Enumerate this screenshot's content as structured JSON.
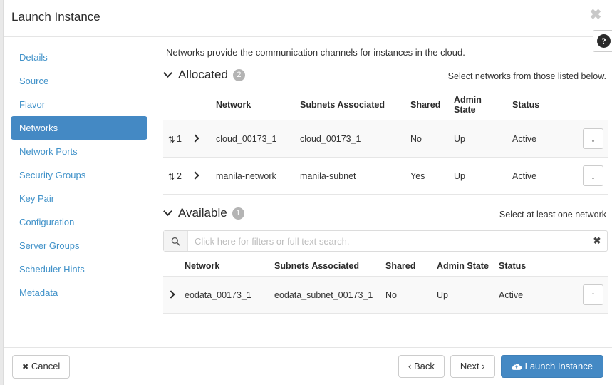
{
  "window": {
    "title": "Launch Instance",
    "close_label": "✖",
    "help_label": "?"
  },
  "sidebar": {
    "items": [
      {
        "label": "Details",
        "active": false
      },
      {
        "label": "Source",
        "active": false
      },
      {
        "label": "Flavor",
        "active": false
      },
      {
        "label": "Networks",
        "active": true
      },
      {
        "label": "Network Ports",
        "active": false
      },
      {
        "label": "Security Groups",
        "active": false
      },
      {
        "label": "Key Pair",
        "active": false
      },
      {
        "label": "Configuration",
        "active": false
      },
      {
        "label": "Server Groups",
        "active": false
      },
      {
        "label": "Scheduler Hints",
        "active": false
      },
      {
        "label": "Metadata",
        "active": false
      }
    ]
  },
  "main": {
    "intro": "Networks provide the communication channels for instances in the cloud.",
    "allocated": {
      "title": "Allocated",
      "count": "2",
      "hint": "Select networks from those listed below.",
      "columns": [
        "",
        "",
        "Network",
        "Subnets Associated",
        "Shared",
        "Admin State",
        "Status",
        ""
      ],
      "rows": [
        {
          "handle": "⇅",
          "index": "1",
          "network": "cloud_00173_1",
          "subnets": "cloud_00173_1",
          "shared": "No",
          "admin_state": "Up",
          "status": "Active",
          "action_icon": "↓",
          "action_name": "deallocate-network-button"
        },
        {
          "handle": "⇅",
          "index": "2",
          "network": "manila-network",
          "subnets": "manila-subnet",
          "shared": "Yes",
          "admin_state": "Up",
          "status": "Active",
          "action_icon": "↓",
          "action_name": "deallocate-network-button"
        }
      ]
    },
    "available": {
      "title": "Available",
      "count": "1",
      "hint": "Select at least one network",
      "search_placeholder": "Click here for filters or full text search.",
      "search_value": "",
      "search_clear_label": "✖",
      "columns": [
        "",
        "Network",
        "Subnets Associated",
        "Shared",
        "Admin State",
        "Status",
        ""
      ],
      "rows": [
        {
          "network": "eodata_00173_1",
          "subnets": "eodata_subnet_00173_1",
          "shared": "No",
          "admin_state": "Up",
          "status": "Active",
          "action_icon": "↑",
          "action_name": "allocate-network-button"
        }
      ]
    }
  },
  "footer": {
    "cancel": "Cancel",
    "cancel_icon": "✖",
    "back": "Back",
    "back_icon": "‹",
    "next": "Next",
    "next_icon": "›",
    "launch": "Launch Instance"
  },
  "colors": {
    "accent": "#4489c4",
    "link": "#4192c9",
    "badge": "#b4b4b4"
  }
}
